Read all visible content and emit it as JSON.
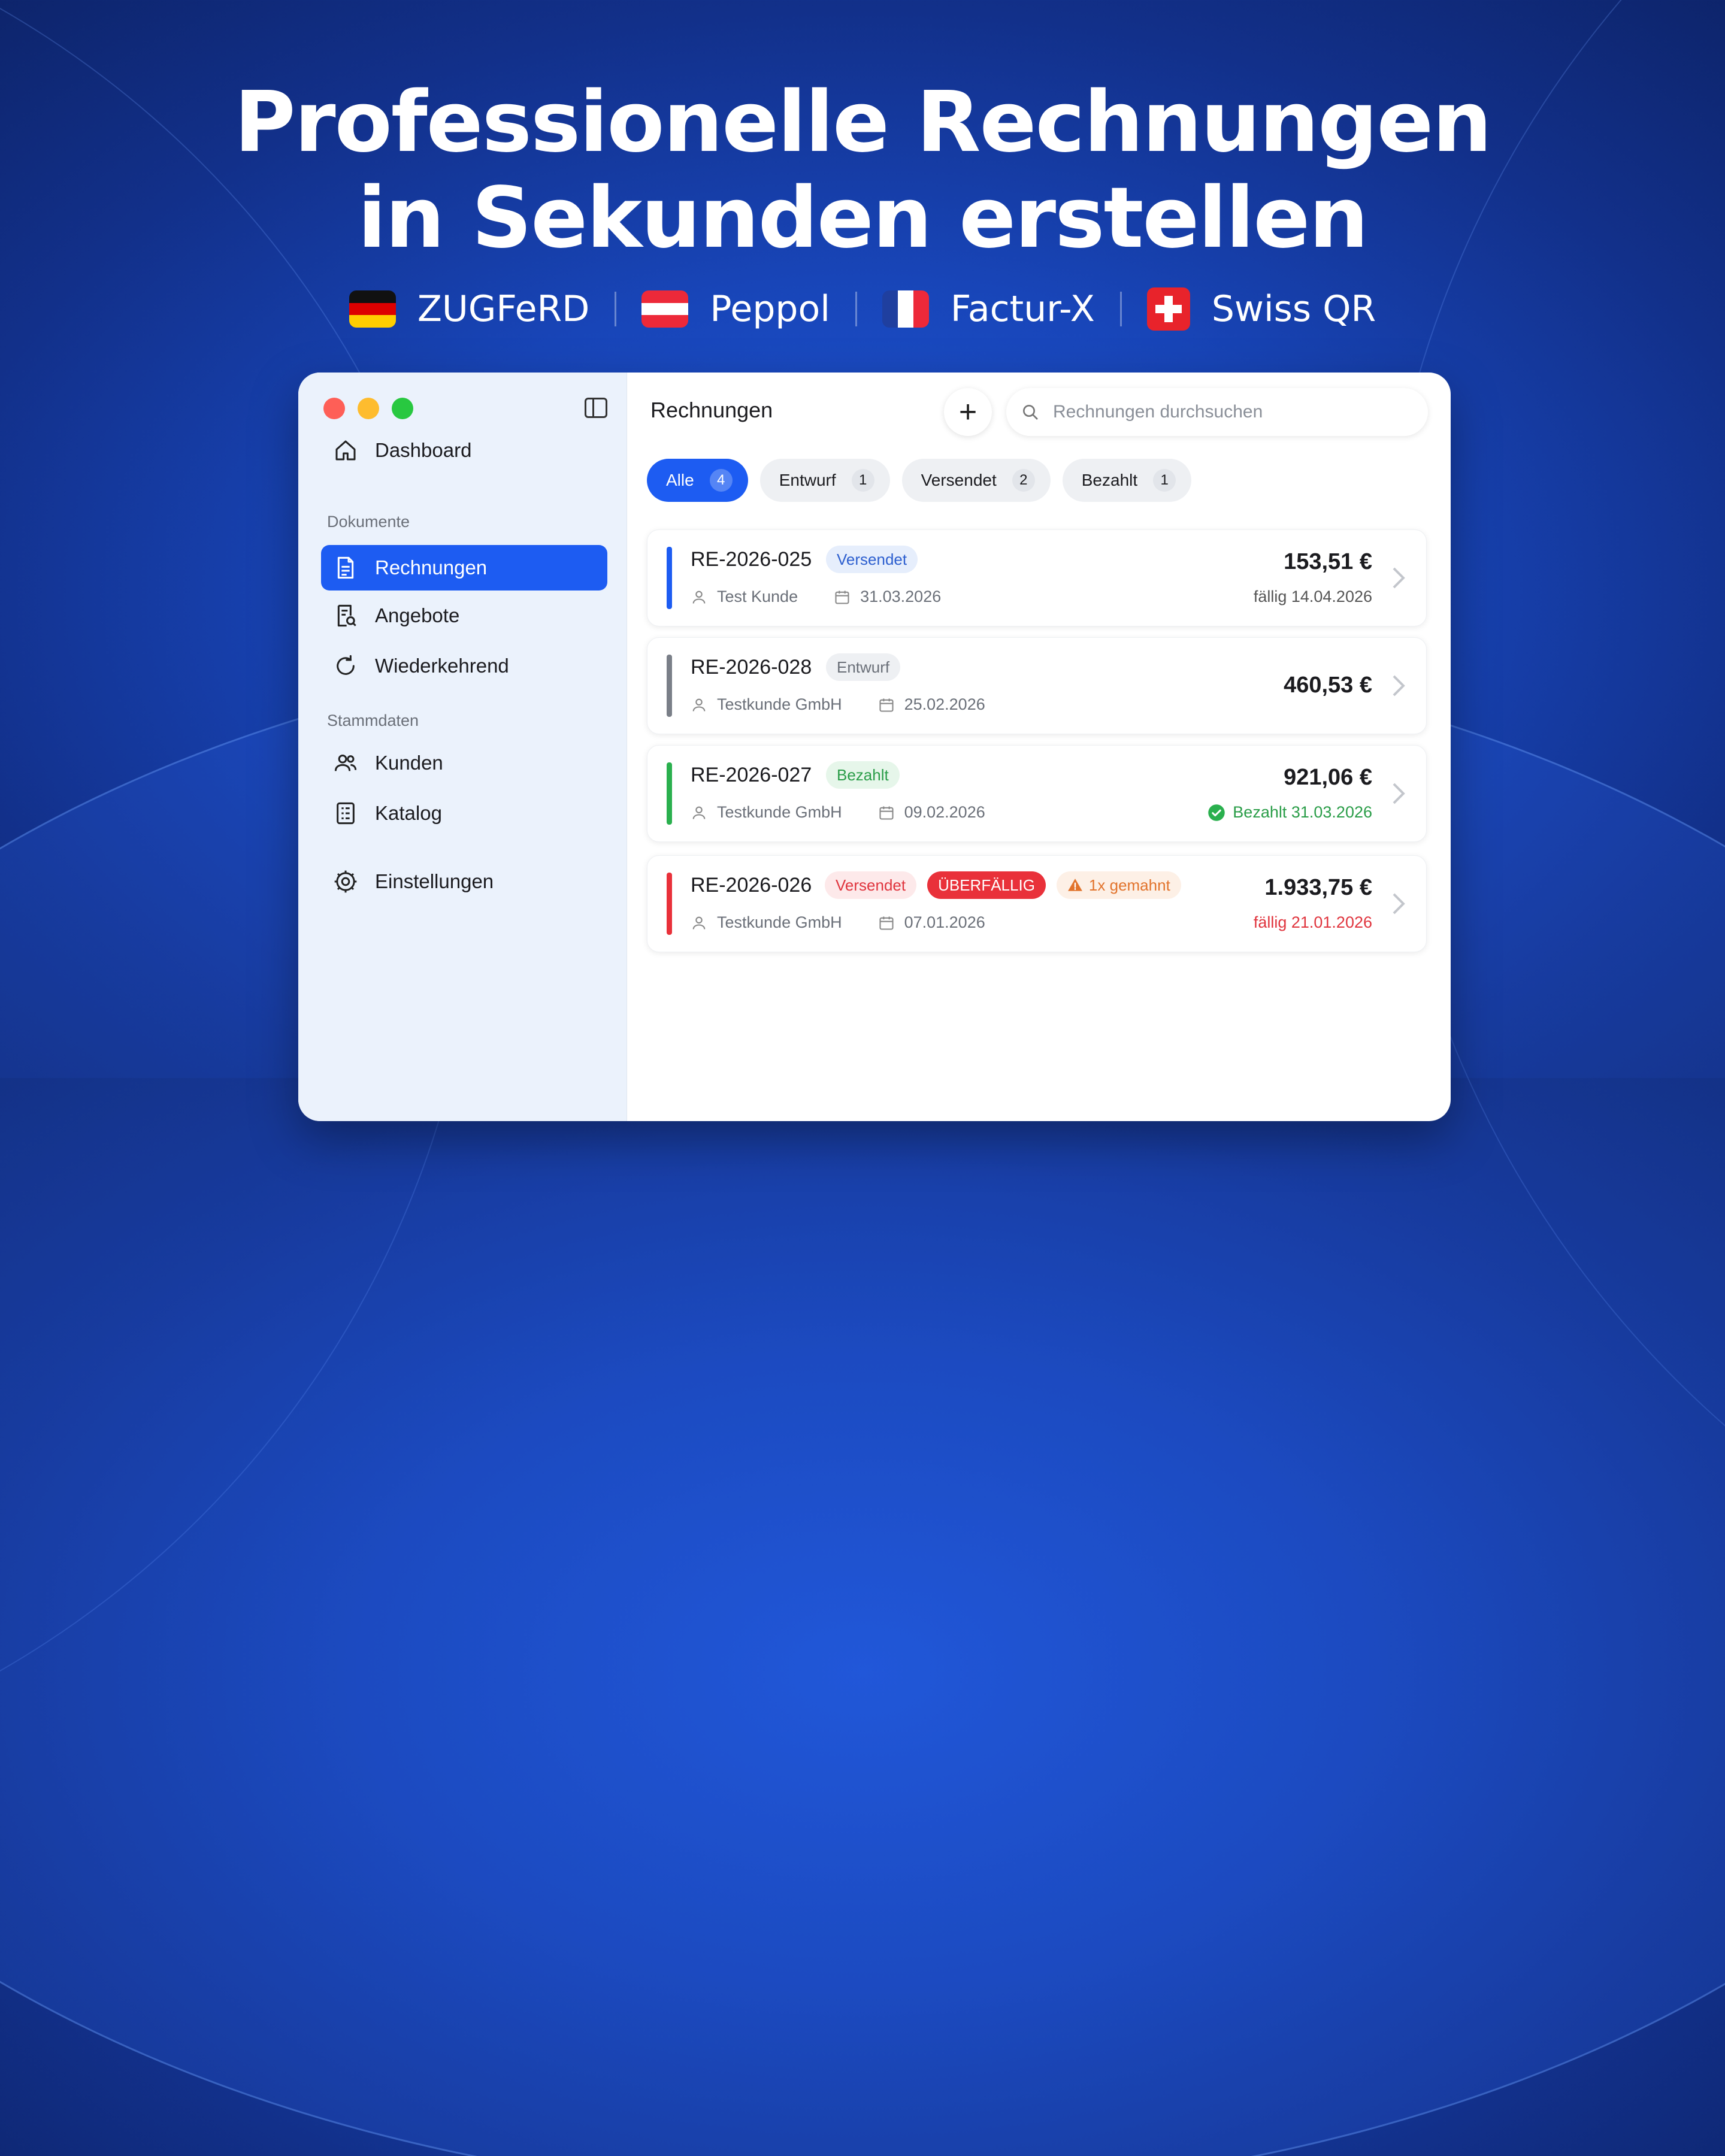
{
  "headline": {
    "line1": "Professionelle Rechnungen",
    "line2": "in Sekunden erstellen"
  },
  "standards": [
    {
      "flag": "flag-germany",
      "label": "ZUGFeRD"
    },
    {
      "flag": "flag-austria",
      "label": "Peppol"
    },
    {
      "flag": "flag-france",
      "label": "Factur-X"
    },
    {
      "flag": "flag-switzerland",
      "label": "Swiss QR"
    }
  ],
  "sidebar": {
    "dashboard": "Dashboard",
    "section_documents": "Dokumente",
    "invoices": "Rechnungen",
    "quotes": "Angebote",
    "recurring": "Wiederkehrend",
    "section_master": "Stammdaten",
    "customers": "Kunden",
    "catalog": "Katalog",
    "settings": "Einstellungen"
  },
  "main": {
    "title": "Rechnungen",
    "add_icon": "plus-icon",
    "search_placeholder": "Rechnungen durchsuchen"
  },
  "filters": [
    {
      "label": "Alle",
      "count": "4",
      "active": true
    },
    {
      "label": "Entwurf",
      "count": "1"
    },
    {
      "label": "Versendet",
      "count": "2"
    },
    {
      "label": "Bezahlt",
      "count": "1"
    }
  ],
  "invoices": [
    {
      "number": "RE-2026-025",
      "status": "Versendet",
      "customer": "Test Kunde",
      "date": "31.03.2026",
      "amount": "153,51 €",
      "due": "fällig 14.04.2026",
      "accent": "#1d5cf2"
    },
    {
      "number": "RE-2026-028",
      "status": "Entwurf",
      "customer": "Testkunde GmbH",
      "date": "25.02.2026",
      "amount": "460,53 €",
      "accent": "#7a7f88"
    },
    {
      "number": "RE-2026-027",
      "status": "Bezahlt",
      "customer": "Testkunde GmbH",
      "date": "09.02.2026",
      "amount": "921,06 €",
      "paid": "Bezahlt 31.03.2026",
      "accent": "#2ab04e"
    },
    {
      "number": "RE-2026-026",
      "status": "Versendet",
      "overdue": "ÜBERFÄLLIG",
      "reminder": "1x gemahnt",
      "customer": "Testkunde GmbH",
      "date": "07.01.2026",
      "amount": "1.933,75 €",
      "due": "fällig 21.01.2026",
      "accent": "#e9313a"
    }
  ]
}
